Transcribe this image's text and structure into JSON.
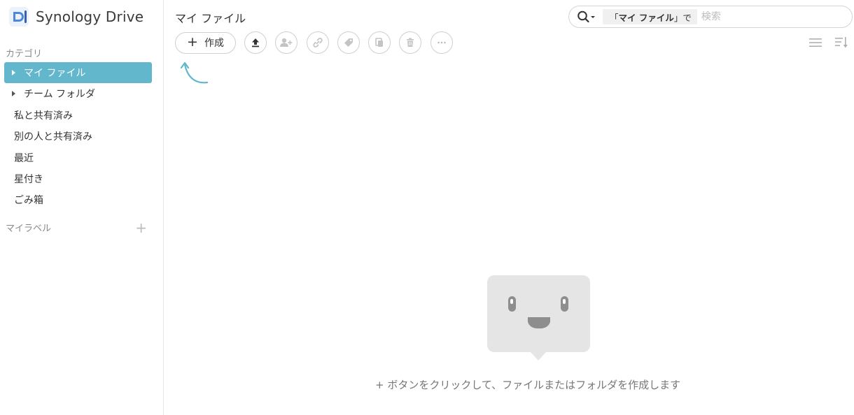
{
  "brand": {
    "name": "Synology Drive"
  },
  "sidebar": {
    "category_label": "カテゴリ",
    "items": [
      {
        "label": "マイ ファイル",
        "active": true,
        "expandable": true
      },
      {
        "label": "チーム フォルダ",
        "active": false,
        "expandable": true
      },
      {
        "label": "私と共有済み",
        "active": false,
        "expandable": false
      },
      {
        "label": "別の人と共有済み",
        "active": false,
        "expandable": false
      },
      {
        "label": "最近",
        "active": false,
        "expandable": false
      },
      {
        "label": "星付き",
        "active": false,
        "expandable": false
      },
      {
        "label": "ごみ箱",
        "active": false,
        "expandable": false
      }
    ],
    "labels_title": "マイラベル",
    "labels_add": "+"
  },
  "header": {
    "title": "マイ ファイル"
  },
  "search": {
    "scope_open": "「",
    "scope_name": "マイ ファイル",
    "scope_close": "」で",
    "placeholder": "検索",
    "value": ""
  },
  "toolbar": {
    "create_plus": "+",
    "create_label": "作成",
    "buttons": [
      {
        "icon": "upload-icon",
        "enabled": true
      },
      {
        "icon": "share-user-icon",
        "enabled": false
      },
      {
        "icon": "link-icon",
        "enabled": false
      },
      {
        "icon": "tag-icon",
        "enabled": false
      },
      {
        "icon": "copy-icon",
        "enabled": false
      },
      {
        "icon": "trash-icon",
        "enabled": false
      },
      {
        "icon": "more-icon",
        "enabled": false
      }
    ],
    "right": [
      "list-view-icon",
      "sort-icon"
    ]
  },
  "empty_state": {
    "message": "+ ボタンをクリックして、ファイルまたはフォルダを作成します"
  },
  "colors": {
    "accent": "#63b7cc",
    "border": "#cfcfcf",
    "muted_text": "#888888",
    "illustration": "#e5e5e5"
  }
}
